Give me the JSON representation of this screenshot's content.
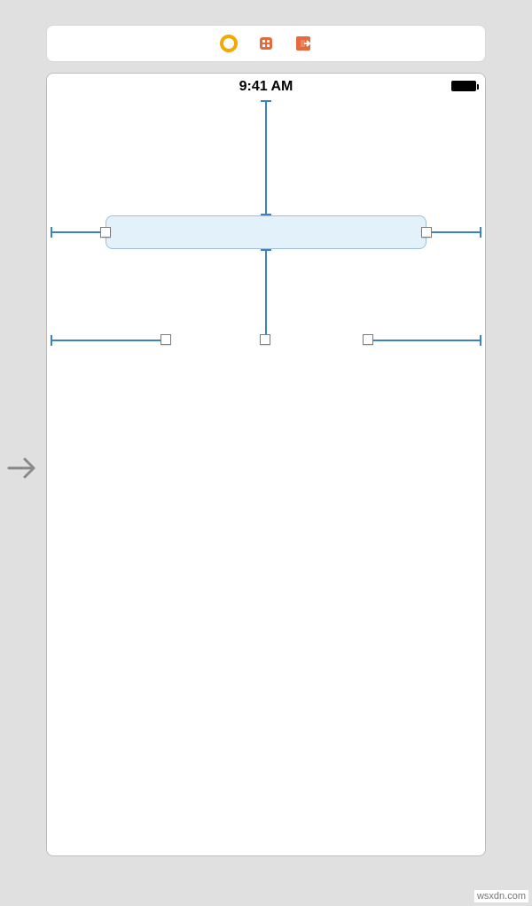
{
  "status_bar": {
    "time": "9:41 AM"
  },
  "toolbar": {
    "icons": {
      "scene": "scene-dock-icon",
      "first_responder": "first-responder-icon",
      "exit": "exit-icon"
    }
  },
  "watermark": "wsxdn.com"
}
